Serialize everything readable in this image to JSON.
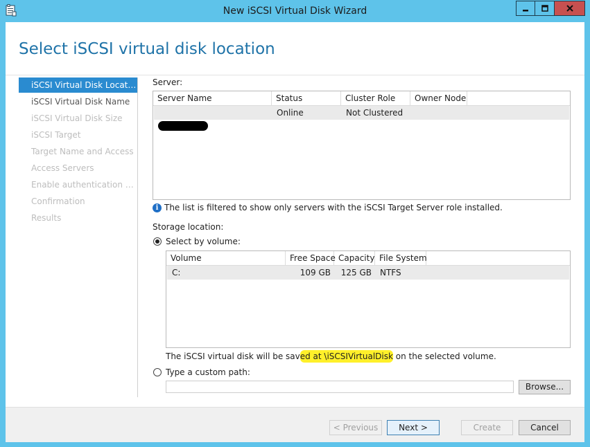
{
  "window": {
    "title": "New iSCSI Virtual Disk Wizard",
    "icon": "wizard-app-icon",
    "controls": {
      "minimize": "minimize-icon",
      "maximize": "maximize-icon",
      "close": "close-icon"
    }
  },
  "page_title": "Select iSCSI virtual disk location",
  "nav": {
    "items": [
      {
        "label": "iSCSI Virtual Disk Location",
        "state": "active"
      },
      {
        "label": "iSCSI Virtual Disk Name",
        "state": "normal"
      },
      {
        "label": "iSCSI Virtual Disk Size",
        "state": "disabled"
      },
      {
        "label": "iSCSI Target",
        "state": "disabled"
      },
      {
        "label": "Target Name and Access",
        "state": "disabled"
      },
      {
        "label": "Access Servers",
        "state": "disabled"
      },
      {
        "label": "Enable authentication ser...",
        "state": "disabled"
      },
      {
        "label": "Confirmation",
        "state": "disabled"
      },
      {
        "label": "Results",
        "state": "disabled"
      }
    ]
  },
  "server": {
    "label": "Server:",
    "columns": [
      "Server Name",
      "Status",
      "Cluster Role",
      "Owner Node"
    ],
    "rows": [
      {
        "server_name": "",
        "status": "Online",
        "cluster_role": "Not Clustered",
        "owner_node": ""
      }
    ],
    "filter_note": "The list is filtered to show only servers with the iSCSI Target Server role installed."
  },
  "storage": {
    "label": "Storage location:",
    "select_by_volume": "Select by volume:",
    "columns": [
      "Volume",
      "Free Space",
      "Capacity",
      "File System"
    ],
    "rows": [
      {
        "volume": "C:",
        "free_space": "109 GB",
        "capacity": "125 GB",
        "file_system": "NTFS"
      }
    ],
    "save_note_pre": "The iSCSI virtual disk will be sav",
    "save_note_mid": "ed at \\iSCSIVirtualDisk",
    "save_note_post": " on the selected volume.",
    "custom_path": "Type a custom path:",
    "custom_path_value": "",
    "browse": "Browse..."
  },
  "buttons": {
    "previous": "< Previous",
    "next": "Next >",
    "create": "Create",
    "cancel": "Cancel"
  }
}
